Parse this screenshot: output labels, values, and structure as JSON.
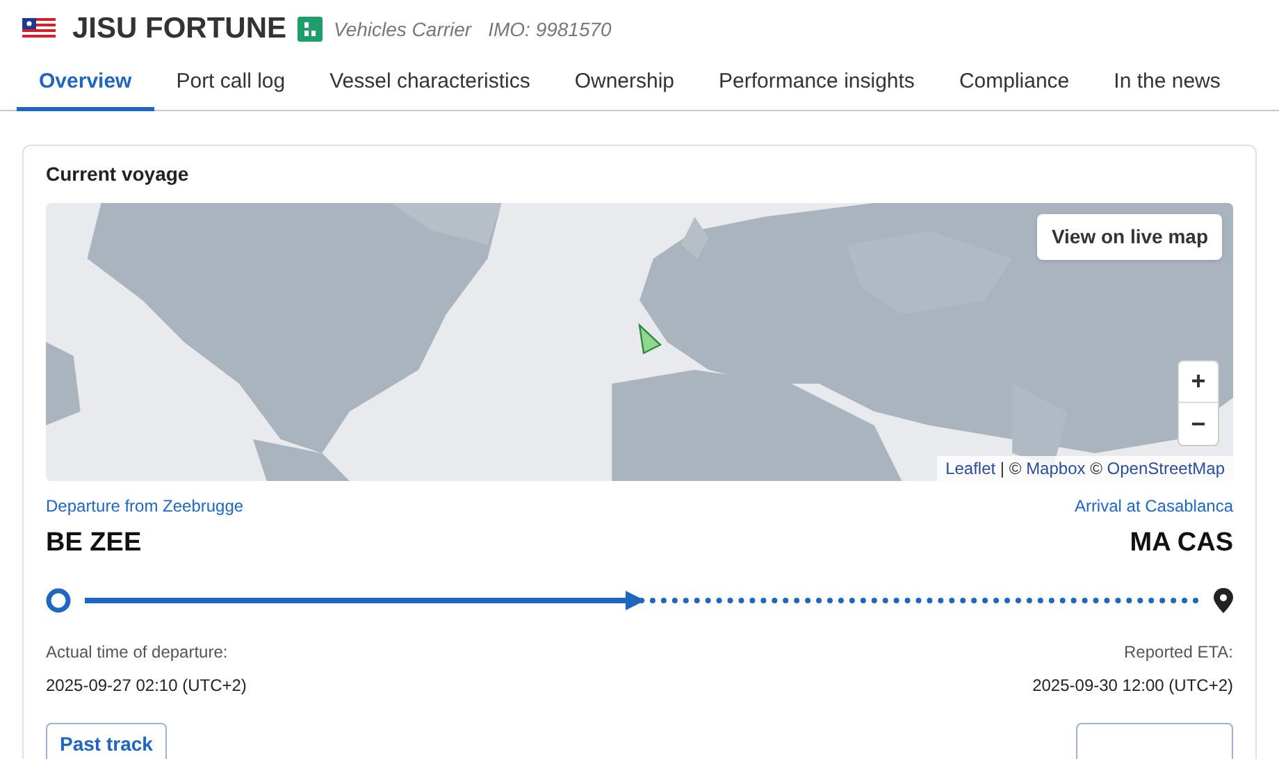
{
  "vessel": {
    "name": "JISU FORTUNE",
    "type": "Vehicles Carrier",
    "imo": "IMO: 9981570"
  },
  "tabs": [
    {
      "label": "Overview",
      "selected": true
    },
    {
      "label": "Port call log",
      "selected": false
    },
    {
      "label": "Vessel characteristics",
      "selected": false
    },
    {
      "label": "Ownership",
      "selected": false
    },
    {
      "label": "Performance insights",
      "selected": false
    },
    {
      "label": "Compliance",
      "selected": false
    },
    {
      "label": "In the news",
      "selected": false
    }
  ],
  "voyage": {
    "title": "Current voyage",
    "map": {
      "kind": "picture",
      "live_button": "View on live map",
      "zoom_in": "+",
      "zoom_out": "−",
      "attribution": [
        {
          "text": "Leaflet",
          "link": true
        },
        {
          "text": " | © ",
          "link": false
        },
        {
          "text": "Mapbox",
          "link": true
        },
        {
          "text": " © ",
          "link": false
        },
        {
          "text": "OpenStreetMap",
          "link": true
        }
      ]
    },
    "departure": {
      "label": "Departure from Zeebrugge",
      "code": "BE ZEE",
      "time_label": "Actual time of departure:",
      "time": "2025-09-27 02:10 (UTC+2)"
    },
    "arrival": {
      "label": "Arrival at Casablanca",
      "code": "MA CAS",
      "time_label": "Reported ETA:",
      "time": "2025-09-30 12:00 (UTC+2)"
    },
    "progress": {
      "level": 0.49
    },
    "buttons": [
      "Past track"
    ]
  }
}
